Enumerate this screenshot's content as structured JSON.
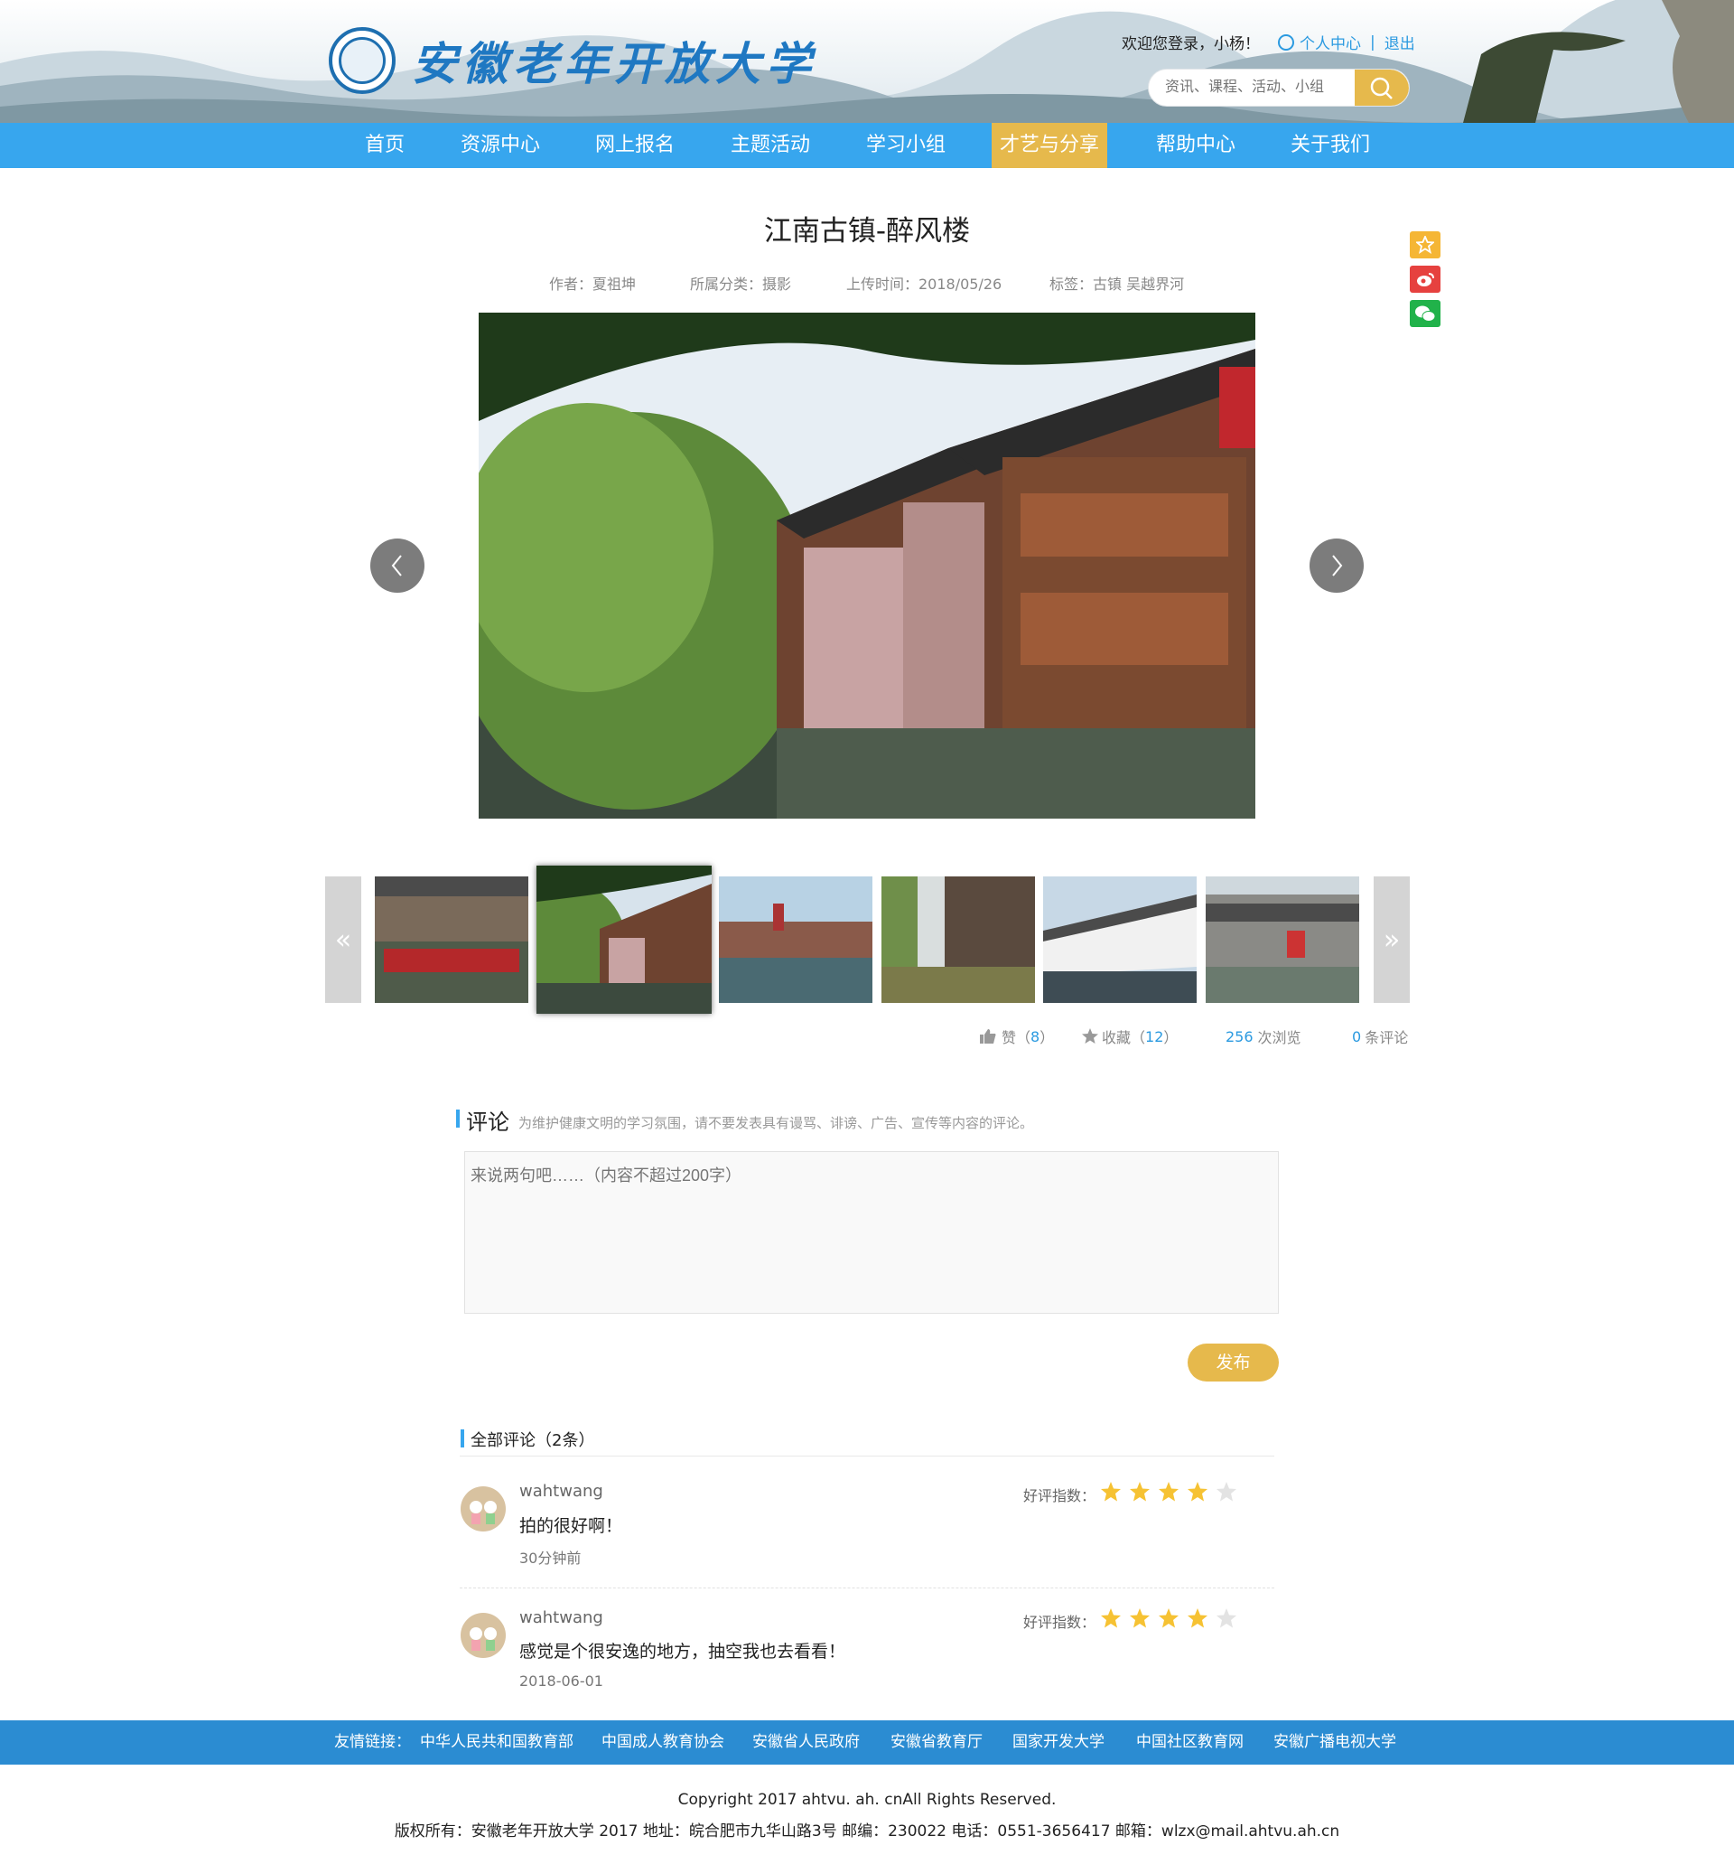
{
  "header": {
    "logo_text": "安徽老年开放大学",
    "welcome": "欢迎您登录，小杨！",
    "personal_center": "个人中心",
    "separator": "|",
    "logout": "退出",
    "search_placeholder": "资讯、课程、活动、小组"
  },
  "nav": {
    "items": [
      "首页",
      "资源中心",
      "网上报名",
      "主题活动",
      "学习小组",
      "才艺与分享",
      "帮助中心",
      "关于我们"
    ],
    "active_index": 5
  },
  "article": {
    "title": "江南古镇-醉风楼",
    "author": "作者：夏祖坤",
    "category": "所属分类：摄影",
    "upload_time": "上传时间：2018/05/26",
    "tags": "标签：古镇 吴越界河"
  },
  "gallery": {
    "prev_label": "«",
    "next_label": "»",
    "active_thumb": 1,
    "thumb_count": 6
  },
  "stats": {
    "like_label": "赞",
    "like_open": "（",
    "like_count": "8",
    "like_close": "）",
    "fav_label": "收藏",
    "fav_open": "（",
    "fav_count": "12",
    "fav_close": "）",
    "views_count": "256",
    "views_label": "次浏览",
    "comments_count": "0",
    "comments_label": "条评论"
  },
  "comment_form": {
    "heading": "评论",
    "note": "为维护健康文明的学习氛围，请不要发表具有谩骂、诽谤、广告、宣传等内容的评论。",
    "placeholder": "来说两句吧……（内容不超过200字）",
    "submit": "发布"
  },
  "comments": {
    "heading": "全部评论（2条）",
    "rating_label": "好评指数：",
    "items": [
      {
        "user": "wahtwang",
        "text": "拍的很好啊！",
        "time": "30分钟前",
        "rating": 4,
        "max": 5
      },
      {
        "user": "wahtwang",
        "text": "感觉是个很安逸的地方，抽空我也去看看！",
        "time": "2018-06-01",
        "rating": 4,
        "max": 5
      }
    ]
  },
  "footer": {
    "links_label": "友情链接：",
    "links": [
      "中华人民共和国教育部",
      "中国成人教育协会",
      "安徽省人民政府",
      "安徽省教育厅",
      "国家开发大学",
      "中国社区教育网",
      "安徽广播电视大学"
    ],
    "copyright": "Copyright 2017 ahtvu. ah. cnAll Rights Reserved.",
    "info": "版权所有：安徽老年开放大学 2017 地址：皖合肥市九华山路3号 邮编：230022 电话：0551-3656417 邮箱：wlzx@mail.ahtvu.ah.cn"
  },
  "colors": {
    "nav_blue": "#37a6ee",
    "accent_gold": "#e6b94c",
    "link_blue": "#2b9ae0",
    "footer_blue": "#2b8cd2",
    "weibo_red": "#e6413f",
    "wechat_green": "#21b24a",
    "star_on": "#f6c233",
    "star_off": "#e3e3e3"
  },
  "icons": [
    "search-icon",
    "user-icon",
    "star-share-icon",
    "weibo-icon",
    "wechat-icon",
    "chevron-left-icon",
    "chevron-right-icon",
    "thumb-up-icon",
    "star-icon"
  ]
}
